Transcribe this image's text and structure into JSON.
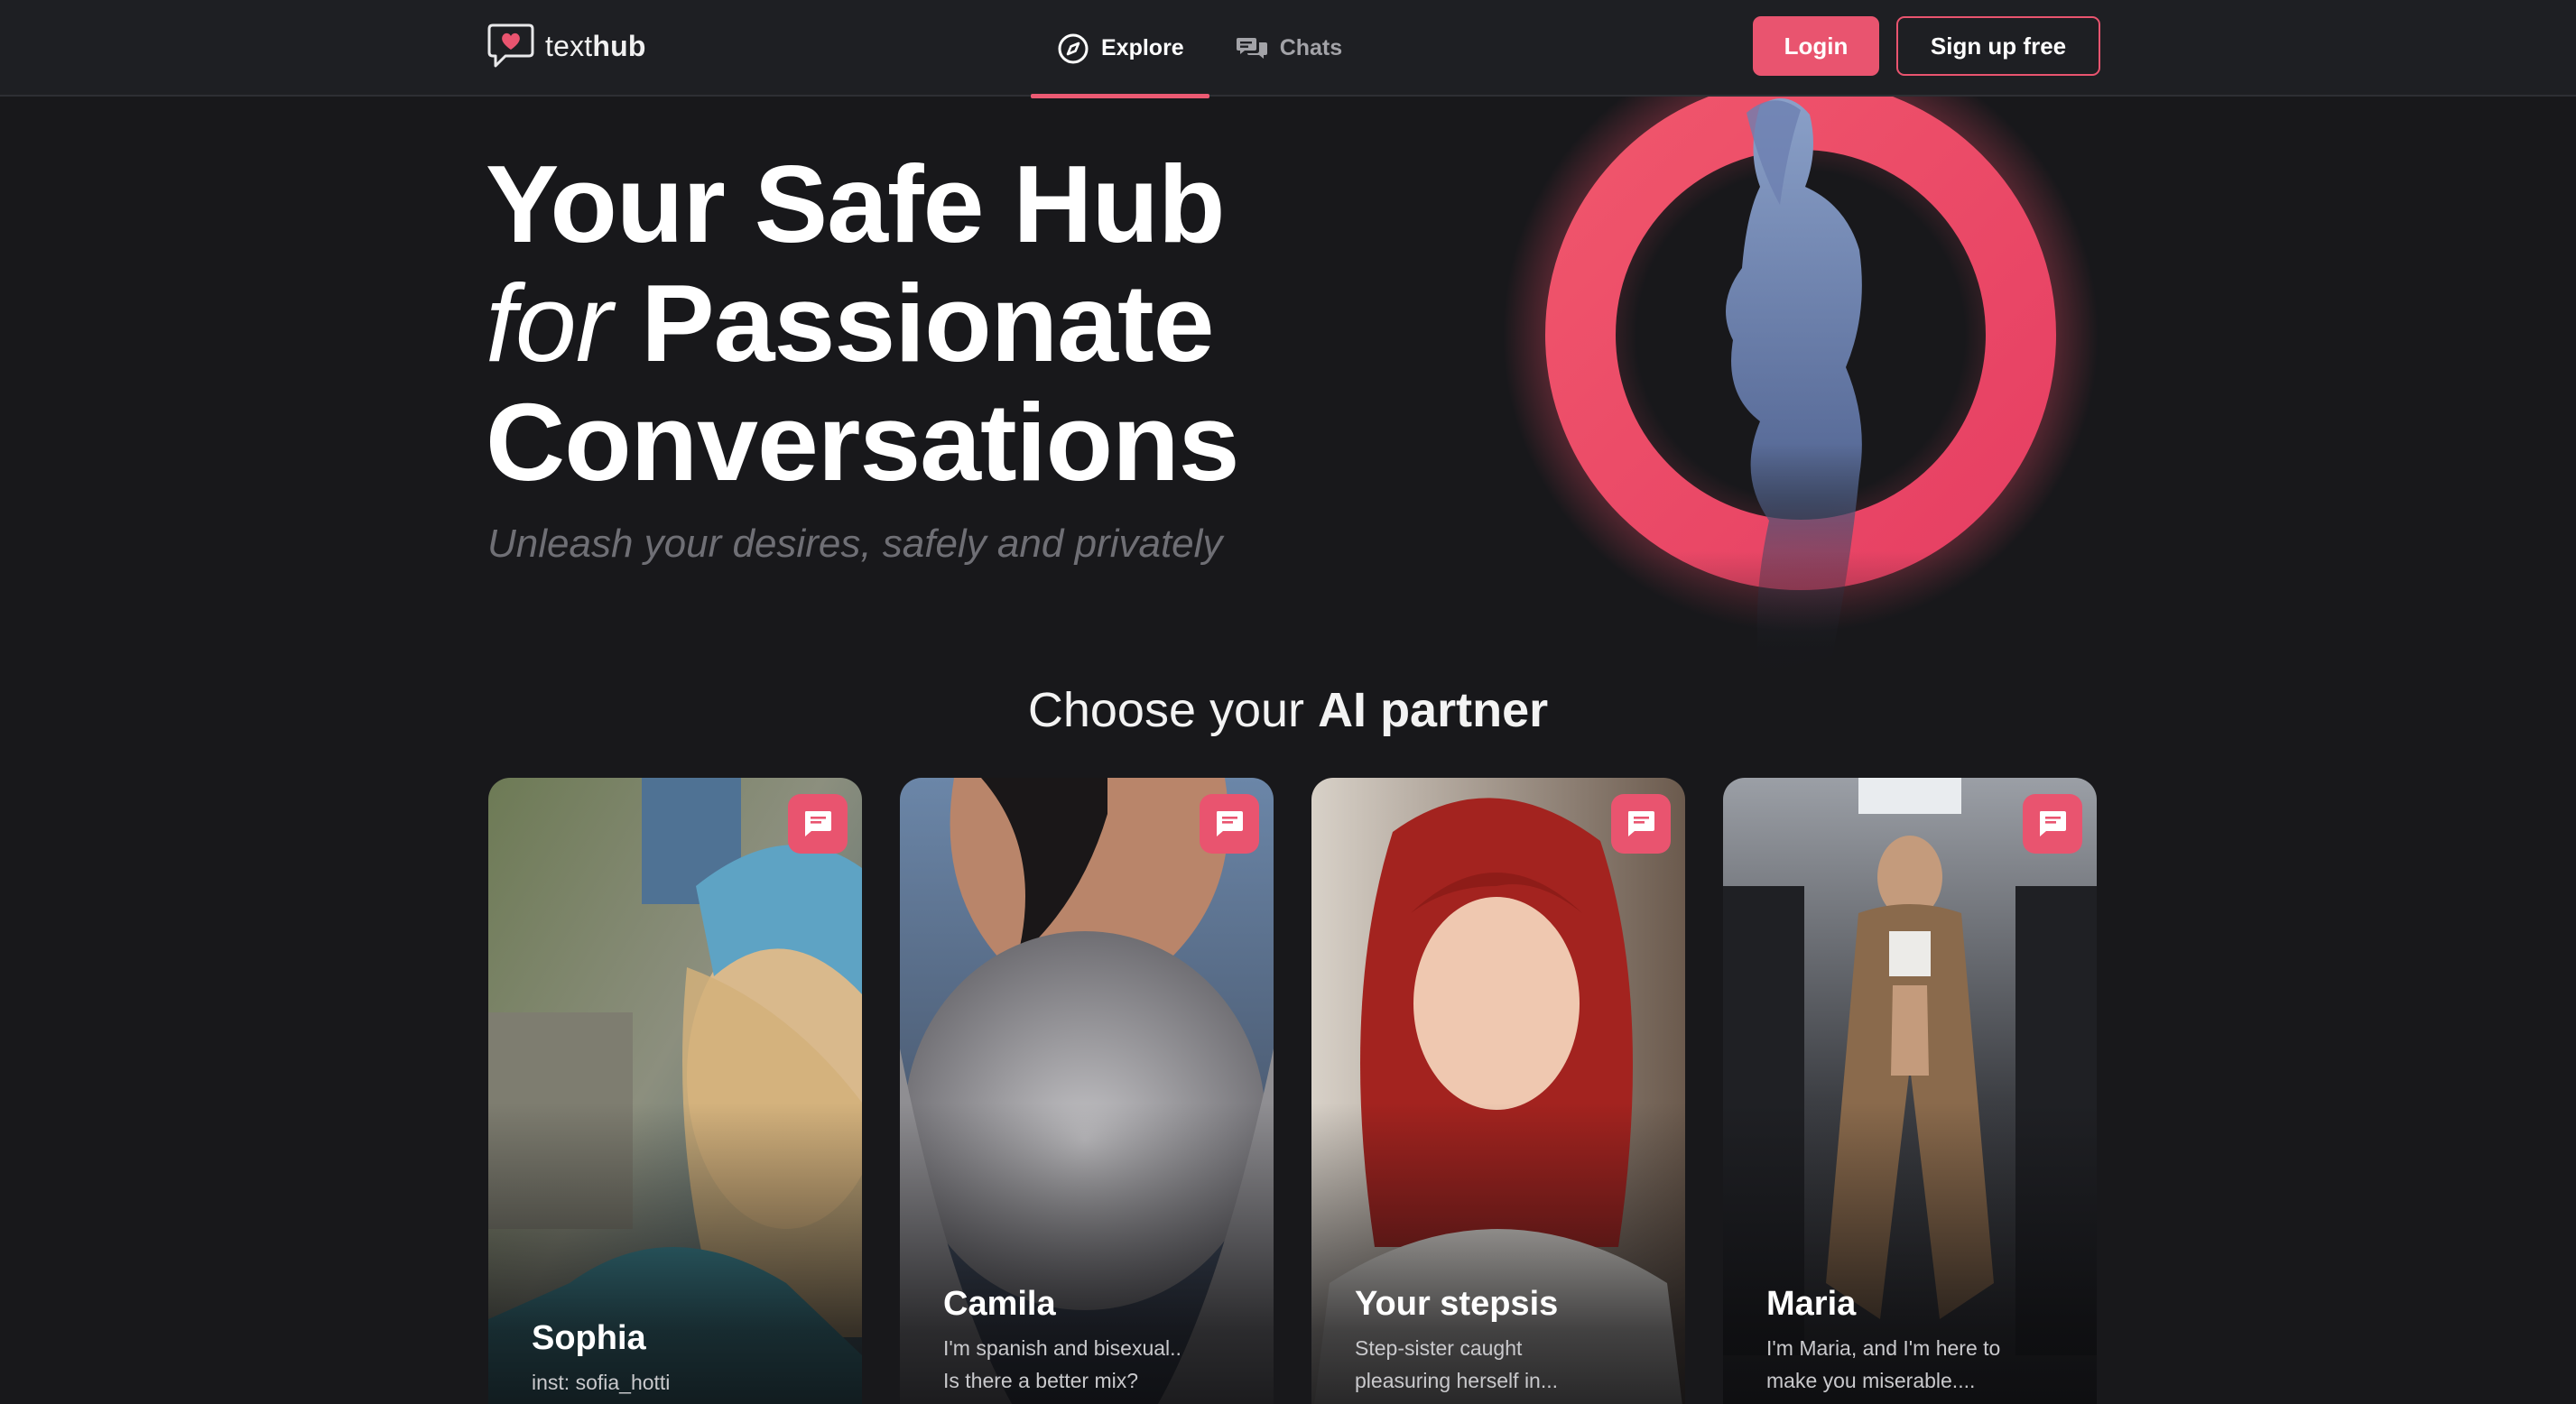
{
  "brand": {
    "name_light": "text",
    "name_bold": "hub",
    "accent": "#e9546f",
    "background": "#18181b"
  },
  "nav": {
    "items": [
      {
        "label": "Explore",
        "icon": "compass-icon",
        "active": true
      },
      {
        "label": "Chats",
        "icon": "chat-bubbles-icon",
        "active": false
      }
    ]
  },
  "auth": {
    "login_label": "Login",
    "signup_label": "Sign up free"
  },
  "hero": {
    "line1": "Your Safe Hub",
    "line2_italic": "for",
    "line2_rest": "Passionate",
    "line3": "Conversations",
    "subtitle": "Unleash your desires, safely and privately"
  },
  "section": {
    "title_prefix": "Choose your",
    "title_bold": "AI partner"
  },
  "cards": [
    {
      "name": "Sophia",
      "desc_line1": "inst: sofia_hotti",
      "desc_line2": "",
      "chat_icon": "message-icon"
    },
    {
      "name": "Camila",
      "desc_line1": "I'm spanish and bisexual..",
      "desc_line2": "Is there a better mix?",
      "chat_icon": "message-icon"
    },
    {
      "name": "Your stepsis",
      "desc_line1": "Step-sister caught",
      "desc_line2": "pleasuring herself in...",
      "chat_icon": "message-icon"
    },
    {
      "name": "Maria",
      "desc_line1": "I'm Maria, and I'm here to",
      "desc_line2": "make you miserable....",
      "chat_icon": "message-icon"
    }
  ]
}
